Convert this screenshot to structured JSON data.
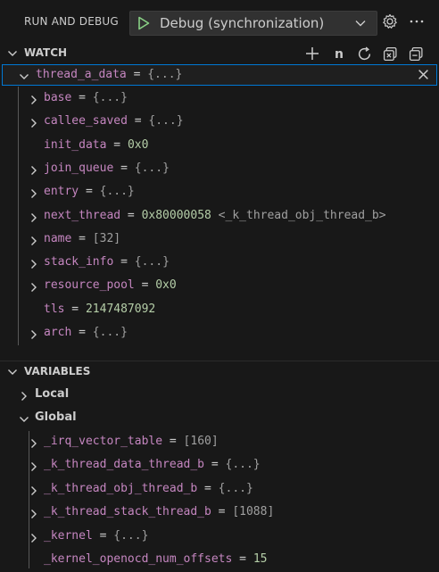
{
  "header": {
    "title": "RUN AND DEBUG",
    "config_label": "Debug (synchronization)"
  },
  "watch": {
    "title": "WATCH",
    "root": {
      "name": "thread_a_data",
      "value": "{...}"
    },
    "items": [
      {
        "name": "base",
        "value": "{...}",
        "expandable": true
      },
      {
        "name": "callee_saved",
        "value": "{...}",
        "expandable": true
      },
      {
        "name": "init_data",
        "value": "0x0",
        "expandable": false
      },
      {
        "name": "join_queue",
        "value": "{...}",
        "expandable": true
      },
      {
        "name": "entry",
        "value": "{...}",
        "expandable": true
      },
      {
        "name": "next_thread",
        "value": "0x80000058 <_k_thread_obj_thread_b>",
        "expandable": true
      },
      {
        "name": "name",
        "value": "[32]",
        "expandable": true
      },
      {
        "name": "stack_info",
        "value": "{...}",
        "expandable": true
      },
      {
        "name": "resource_pool",
        "value": "0x0",
        "expandable": true
      },
      {
        "name": "tls",
        "value": "2147487092",
        "expandable": false
      },
      {
        "name": "arch",
        "value": "{...}",
        "expandable": true
      }
    ]
  },
  "variables": {
    "title": "VARIABLES",
    "local_label": "Local",
    "global_label": "Global",
    "items": [
      {
        "name": "_irq_vector_table",
        "value": "[160]",
        "expandable": true
      },
      {
        "name": "_k_thread_data_thread_b",
        "value": "{...}",
        "expandable": true
      },
      {
        "name": "_k_thread_obj_thread_b",
        "value": "{...}",
        "expandable": true
      },
      {
        "name": "_k_thread_stack_thread_b",
        "value": "[1088]",
        "expandable": true
      },
      {
        "name": "_kernel",
        "value": "{...}",
        "expandable": true
      },
      {
        "name": "_kernel_openocd_num_offsets",
        "value": "15",
        "expandable": false
      }
    ]
  },
  "colors": {
    "background": "#181818",
    "selection_border": "#0078d4",
    "variable_name": "#c586c0",
    "number_value": "#b5cea8",
    "run_green": "#89d185"
  }
}
